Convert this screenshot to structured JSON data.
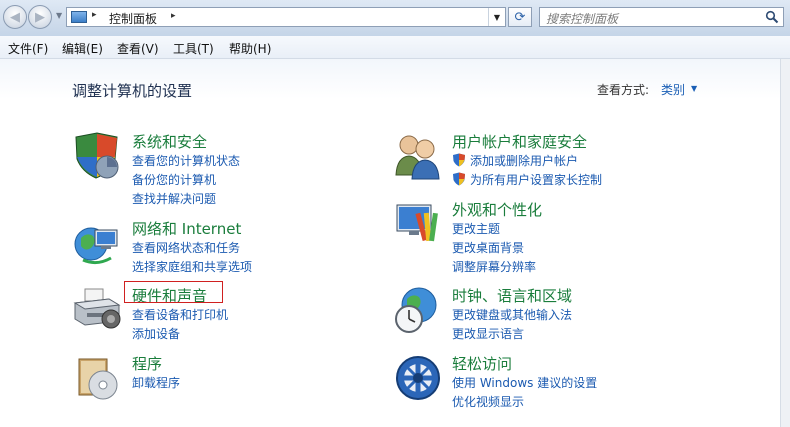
{
  "address_bar": {
    "breadcrumb": "控制面板",
    "sep1": "▸",
    "sep2": "▸",
    "dropdown": "▼",
    "refresh_glyph": "⟳",
    "search_placeholder": "搜索控制面板",
    "icons": {
      "back": "back-arrow-icon",
      "forward": "forward-arrow-icon",
      "location": "control-panel-icon",
      "search": "magnifier-icon"
    }
  },
  "menu": [
    "文件(F)",
    "编辑(E)",
    "查看(V)",
    "工具(T)",
    "帮助(H)"
  ],
  "main": {
    "title": "调整计算机的设置",
    "view_by_label": "查看方式:",
    "view_by_value": "类别",
    "view_by_arrow": "▼"
  },
  "categories": [
    {
      "title": "系统和安全",
      "icon": "shield-icon",
      "links": [
        "查看您的计算机状态",
        "备份您的计算机",
        "查找并解决问题"
      ]
    },
    {
      "title": "网络和 Internet",
      "icon": "network-globe-icon",
      "links": [
        "查看网络状态和任务",
        "选择家庭组和共享选项"
      ]
    },
    {
      "title": "硬件和声音",
      "icon": "printer-icon",
      "links": [
        "查看设备和打印机",
        "添加设备"
      ],
      "highlighted": true
    },
    {
      "title": "程序",
      "icon": "programs-disc-icon",
      "links": [
        "卸载程序"
      ]
    },
    {
      "title": "用户帐户和家庭安全",
      "icon": "users-icon",
      "links": [
        "添加或删除用户帐户",
        "为所有用户设置家长控制"
      ],
      "link_icon": "uac-shield-icon"
    },
    {
      "title": "外观和个性化",
      "icon": "monitor-palette-icon",
      "links": [
        "更改主题",
        "更改桌面背景",
        "调整屏幕分辨率"
      ]
    },
    {
      "title": "时钟、语言和区域",
      "icon": "clock-globe-icon",
      "links": [
        "更改键盘或其他输入法",
        "更改显示语言"
      ]
    },
    {
      "title": "轻松访问",
      "icon": "ease-of-access-icon",
      "links": [
        "使用 Windows 建议的设置",
        "优化视频显示"
      ]
    }
  ]
}
